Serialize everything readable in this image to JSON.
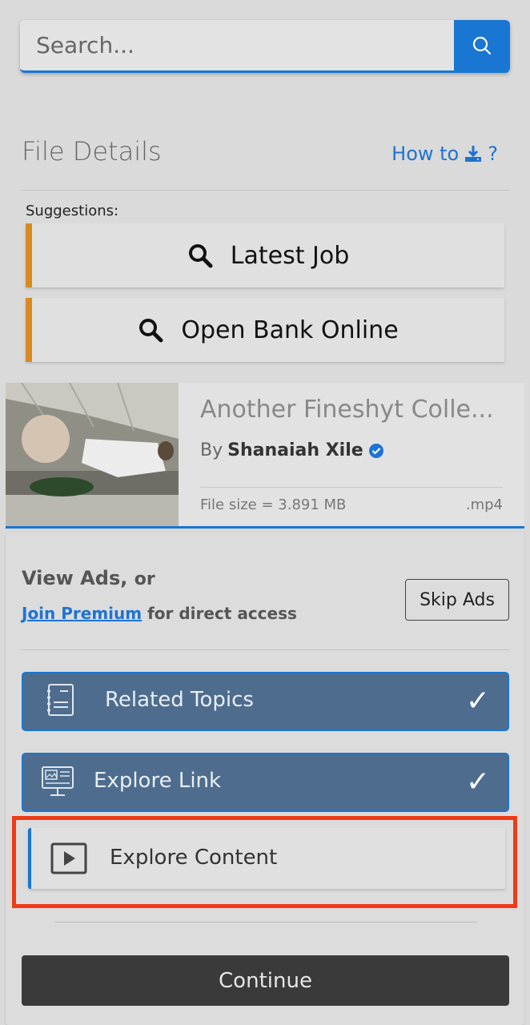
{
  "search": {
    "placeholder": "Search..."
  },
  "header": {
    "title": "File Details",
    "howto_label": "How to",
    "howto_suffix": "?"
  },
  "suggestions": {
    "label": "Suggestions:",
    "items": [
      {
        "label": "Latest Job",
        "icon": "search-icon"
      },
      {
        "label": "Open Bank Online",
        "icon": "search-icon"
      }
    ]
  },
  "file": {
    "title": "Another Fineshyt Colle...",
    "by_prefix": "By",
    "author": "Shanaiah Xile",
    "size": "File size = 3.891 MB",
    "ext": ".mp4"
  },
  "access": {
    "view_ads": "View Ads,",
    "or": "or",
    "join_premium": "Join Premium",
    "direct_access": "for direct access",
    "skip_ads": "Skip Ads"
  },
  "steps": [
    {
      "label": "Related Topics",
      "done": true,
      "icon": "list-icon"
    },
    {
      "label": "Explore Link",
      "done": true,
      "icon": "monitor-icon"
    },
    {
      "label": "Explore Content",
      "done": false,
      "icon": "play-icon"
    }
  ],
  "check_glyph": "✓",
  "continue_label": "Continue",
  "colors": {
    "accent": "#1976d2",
    "suggest_bar": "#d88a21",
    "step_done_bg": "#4e6d8e",
    "highlight": "#f03a17",
    "continue_bg": "#3a3a3a"
  }
}
